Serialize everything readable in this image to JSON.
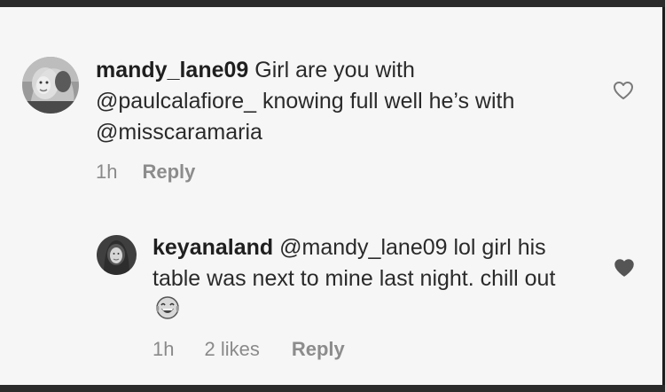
{
  "comments": [
    {
      "username": "mandy_lane09",
      "text": " Girl are you with @paulcalafiore_ knowing full well he’s with @misscaramaria",
      "time": "1h",
      "likes": "",
      "reply": "Reply",
      "liked": false
    },
    {
      "username": "keyanaland",
      "text": " @mandy_lane09 lol girl his table was next to mine last night. chill out",
      "emoji": "tears-of-joy-emoji",
      "time": "1h",
      "likes": "2 likes",
      "reply": "Reply",
      "liked": true
    }
  ],
  "colors": {
    "background": "#f6f6f6",
    "border": "#2b2b2b",
    "text": "#2a2a2a",
    "meta": "#8a8a8a",
    "heart_filled": "#555555",
    "heart_outline": "#7a7a7a"
  }
}
